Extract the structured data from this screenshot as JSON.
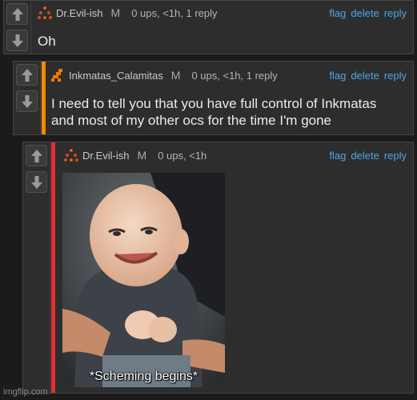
{
  "comments": [
    {
      "username": "Dr.Evil-ish",
      "gender": "M",
      "stats": "0 ups, <1h, 1 reply",
      "actions": [
        "flag",
        "delete",
        "reply"
      ],
      "text": "Oh"
    },
    {
      "username": "Inkmatas_Calamitas",
      "gender": "M",
      "stats": "0 ups, <1h, 1 reply",
      "actions": [
        "flag",
        "delete",
        "reply"
      ],
      "text_lines": [
        "I need to tell you that you have full control of Inkmatas",
        "and most of my other ocs for the time I'm gone"
      ]
    },
    {
      "username": "Dr.Evil-ish",
      "gender": "M",
      "stats": "0 ups, <1h",
      "actions": [
        "flag",
        "delete",
        "reply"
      ],
      "image_caption": "*Scheming begins*"
    }
  ],
  "icons": {
    "upvote": "arrow-up-icon",
    "downvote": "arrow-down-icon",
    "avatar_dr_evil": "triangle-dots-avatar",
    "avatar_inkmatas": "orange-pixel-avatar"
  },
  "colors": {
    "accent_link": "#4ea6e6",
    "stripe_reply1": "#f08c00",
    "stripe_reply2": "#e03030"
  },
  "watermark": "imgflip.com"
}
